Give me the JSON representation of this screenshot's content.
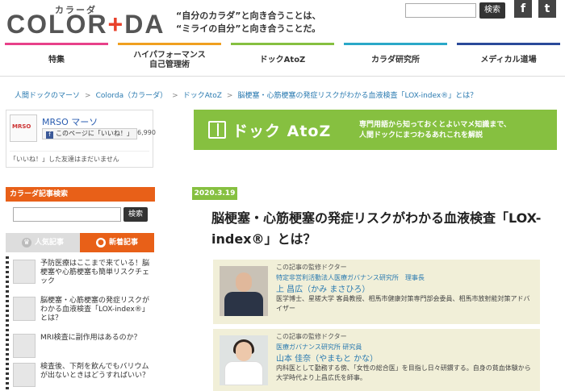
{
  "header": {
    "logo_kana": "カラーダ",
    "logo_left": "COLOR",
    "logo_plus": "+",
    "logo_right": "DA",
    "tagline_1": "“自分のカラダ”と向き合うことは、",
    "tagline_2": "“ミライの自分”と向き合うことだ。",
    "search_button": "検索",
    "facebook_icon": "f",
    "twitter_icon": "t"
  },
  "nav": [
    {
      "label": "特集",
      "color": "#e8418a"
    },
    {
      "label": "ハイパフォーマンス\n自己管理術",
      "color": "#f0a020"
    },
    {
      "label": "ドックAtoZ",
      "color": "#86c040"
    },
    {
      "label": "カラダ研究所",
      "color": "#2aa8c8"
    },
    {
      "label": "メディカル道場",
      "color": "#2a4a9a"
    }
  ],
  "breadcrumb": [
    "人間ドックのマーソ",
    "Colorda（カラーダ）",
    "ドックAtoZ",
    "脳梗塞・心筋梗塞の発症リスクがわかる血液検査「LOX-index®」とは？"
  ],
  "breadcrumb_sep": ">",
  "facebook": {
    "thumb_text": "MRSO",
    "name": "MRSO マーソ",
    "like_label": "このページに「いいね！」",
    "count": "6,990",
    "note": "「いいね！」した友達はまだいません"
  },
  "sidebar": {
    "search_title": "カラーダ記事検索",
    "search_button": "検索",
    "tab_popular": "人気記事",
    "tab_new": "新着記事",
    "articles": [
      "予防医療はここまで来ている！脳梗塞や心筋梗塞も簡単リスクチェック",
      "脳梗塞・心筋梗塞の発症リスクがわかる血液検査「LOX-index®」とは？",
      "MRI検査に副作用はあるのか？",
      "検査後、下剤を飲んでもバリウムが出ないときはどうすればいい？"
    ]
  },
  "hero": {
    "title": "ドック AtoZ",
    "desc_1": "専門用語から知っておくとよいマメ知識まで、",
    "desc_2": "人間ドックにまつわるあれこれを解説"
  },
  "article": {
    "date": "2020.3.19",
    "title": "脳梗塞・心筋梗塞の発症リスクがわかる血液検査「LOX-index®」とは？"
  },
  "doctors": [
    {
      "head": "この記事の監修ドクター",
      "org": "特定非営利活動法人医療ガバナンス研究所　理事長",
      "name": "上 昌広（かみ まさひろ）",
      "bio": "医学博士、星槎大学 客員教授、相馬市健康対策専門部会委員、相馬市放射能対策アドバイザー"
    },
    {
      "head": "この記事の監修ドクター",
      "org": "医療ガバナンス研究所 研究員",
      "name": "山本 佳奈（やまもと かな）",
      "bio": "内科医として勤務する傍、「女性の総合医」を目指し日々研鑽する。自身の貧血体験から大学時代より上昌広氏を師事。"
    }
  ]
}
